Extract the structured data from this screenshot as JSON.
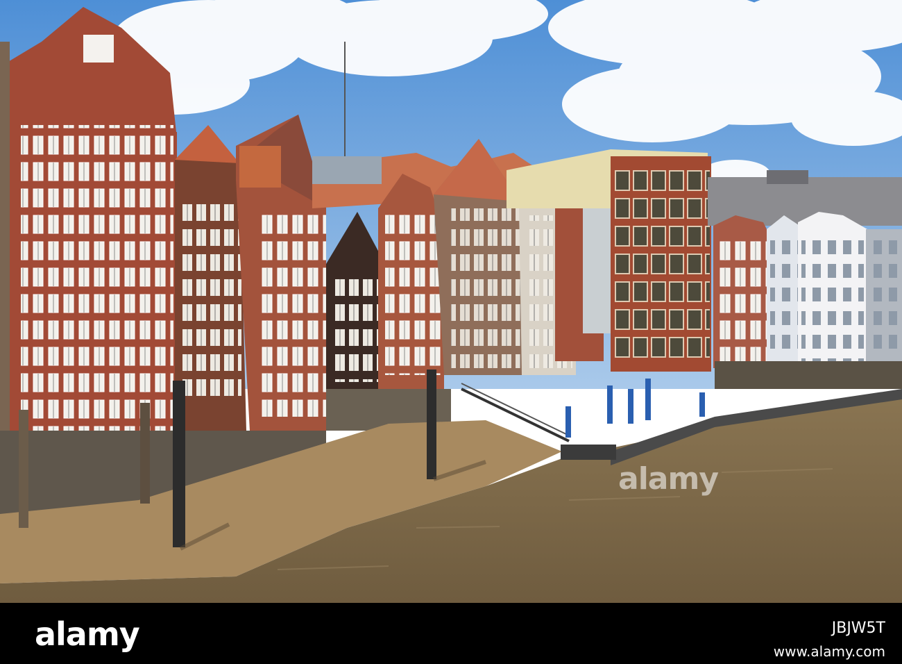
{
  "watermark": {
    "text": "alamy"
  },
  "footer": {
    "logo": "alamy",
    "image_code": "JBJW5T",
    "url": "www.alamy.com"
  },
  "colors": {
    "sky": "#5b9ad8",
    "water": "#7d6a48",
    "mud": "#ad8f64",
    "brick": "#9a4a34",
    "strip": "#000000"
  }
}
